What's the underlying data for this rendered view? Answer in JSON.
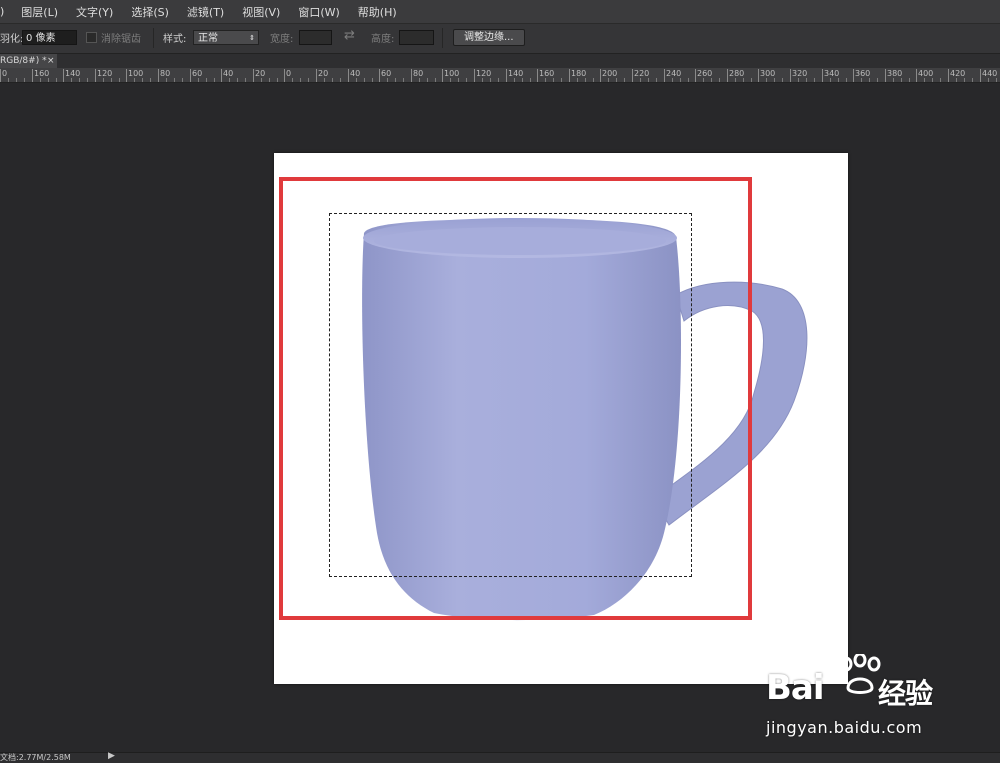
{
  "menubar": {
    "items": [
      ")",
      "图层(L)",
      "文字(Y)",
      "选择(S)",
      "滤镜(T)",
      "视图(V)",
      "窗口(W)",
      "帮助(H)"
    ]
  },
  "options_bar": {
    "feather_label": "羽化:",
    "feather_value": "0 像素",
    "antialias_label": "消除锯齿",
    "style_label": "样式:",
    "style_value": "正常",
    "width_label": "宽度:",
    "height_label": "高度:",
    "refine_edge_button": "调整边缘..."
  },
  "document_tab": {
    "title": "RGB/8#) *",
    "close": "×"
  },
  "ruler": {
    "labels": [
      "0",
      "160",
      "140",
      "120",
      "100",
      "80",
      "60",
      "40",
      "20",
      "0",
      "20",
      "40",
      "60",
      "80",
      "100",
      "120",
      "140",
      "160",
      "180",
      "200",
      "220",
      "240",
      "260",
      "280",
      "300",
      "320",
      "340",
      "360",
      "380",
      "400",
      "420",
      "440"
    ]
  },
  "canvas": {
    "mug_color": "#a5acd9",
    "highlight_color": "#e03a3c"
  },
  "status": {
    "text": "文档:2.77M/2.58M"
  },
  "watermark": {
    "brand": "Bai du 经验",
    "brand_left": "Bai",
    "brand_right": "经验",
    "url": "jingyan.baidu.com"
  }
}
